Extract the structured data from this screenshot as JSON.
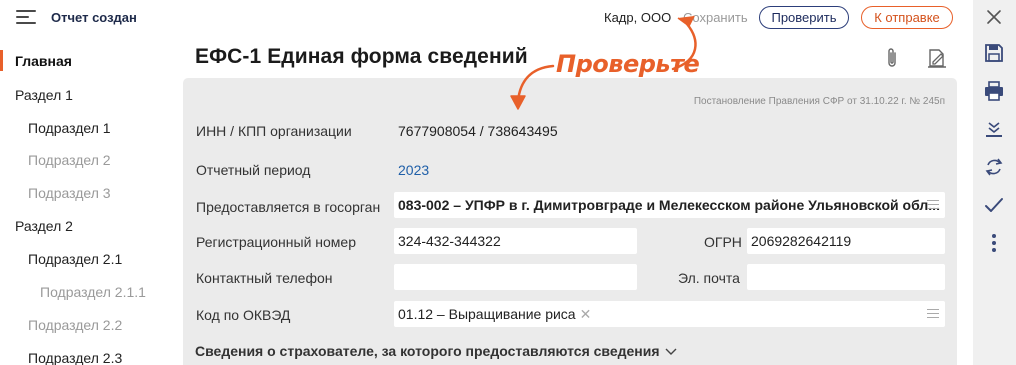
{
  "header": {
    "title": "Отчет создан",
    "org_name": "Кадр, ООО",
    "save_label": "Сохранить",
    "check_label": "Проверить",
    "send_label": "К отправке"
  },
  "sidebar": {
    "items": [
      {
        "label": "Главная"
      },
      {
        "label": "Раздел 1"
      },
      {
        "label": "Подраздел 1"
      },
      {
        "label": "Подраздел 2"
      },
      {
        "label": "Подраздел 3"
      },
      {
        "label": "Раздел 2"
      },
      {
        "label": "Подраздел 2.1"
      },
      {
        "label": "Подраздел 2.1.1"
      },
      {
        "label": "Подраздел 2.2"
      },
      {
        "label": "Подраздел 2.3"
      }
    ]
  },
  "main": {
    "title": "ЕФС-1 Единая форма сведений",
    "decree": "Постановление Правления СФР от 31.10.22 г. № 245п",
    "annotation": "Проверьте",
    "fields": {
      "inn_label": "ИНН / КПП организации",
      "inn_value": "7677908054 / 738643495",
      "period_label": "Отчетный период",
      "period_value": "2023",
      "agency_label": "Предоставляется в госорган",
      "agency_value": "083-002 – УПФР в г. Димитровграде и Мелекесском районе Ульяновской обл...",
      "reg_label": "Регистрационный номер",
      "reg_value": "324-432-344322",
      "ogrn_label": "ОГРН",
      "ogrn_value": "2069282642119",
      "phone_label": "Контактный телефон",
      "phone_value": "",
      "email_label": "Эл. почта",
      "email_value": "",
      "okved_label": "Код по ОКВЭД",
      "okved_value": "01.12 – Выращивание риса"
    },
    "section_toggle": "Сведения о страхователе, за которого предоставляются сведения"
  },
  "icons": {
    "menu": "hamburger-menu-icon",
    "attach": "paperclip-icon",
    "document": "document-edit-icon",
    "close": "close-icon",
    "save": "floppy-disk-icon",
    "print": "printer-icon",
    "download": "download-tray-icon",
    "convert": "convert-arrows-icon",
    "check": "checkmark-icon",
    "more": "more-vertical-icon"
  },
  "colors": {
    "accent_orange": "#e8602a",
    "navy": "#2c3e7a",
    "link_blue": "#1f5fa8",
    "card_bg": "#ebebeb",
    "toolbar_bg": "#f0f0f0"
  }
}
